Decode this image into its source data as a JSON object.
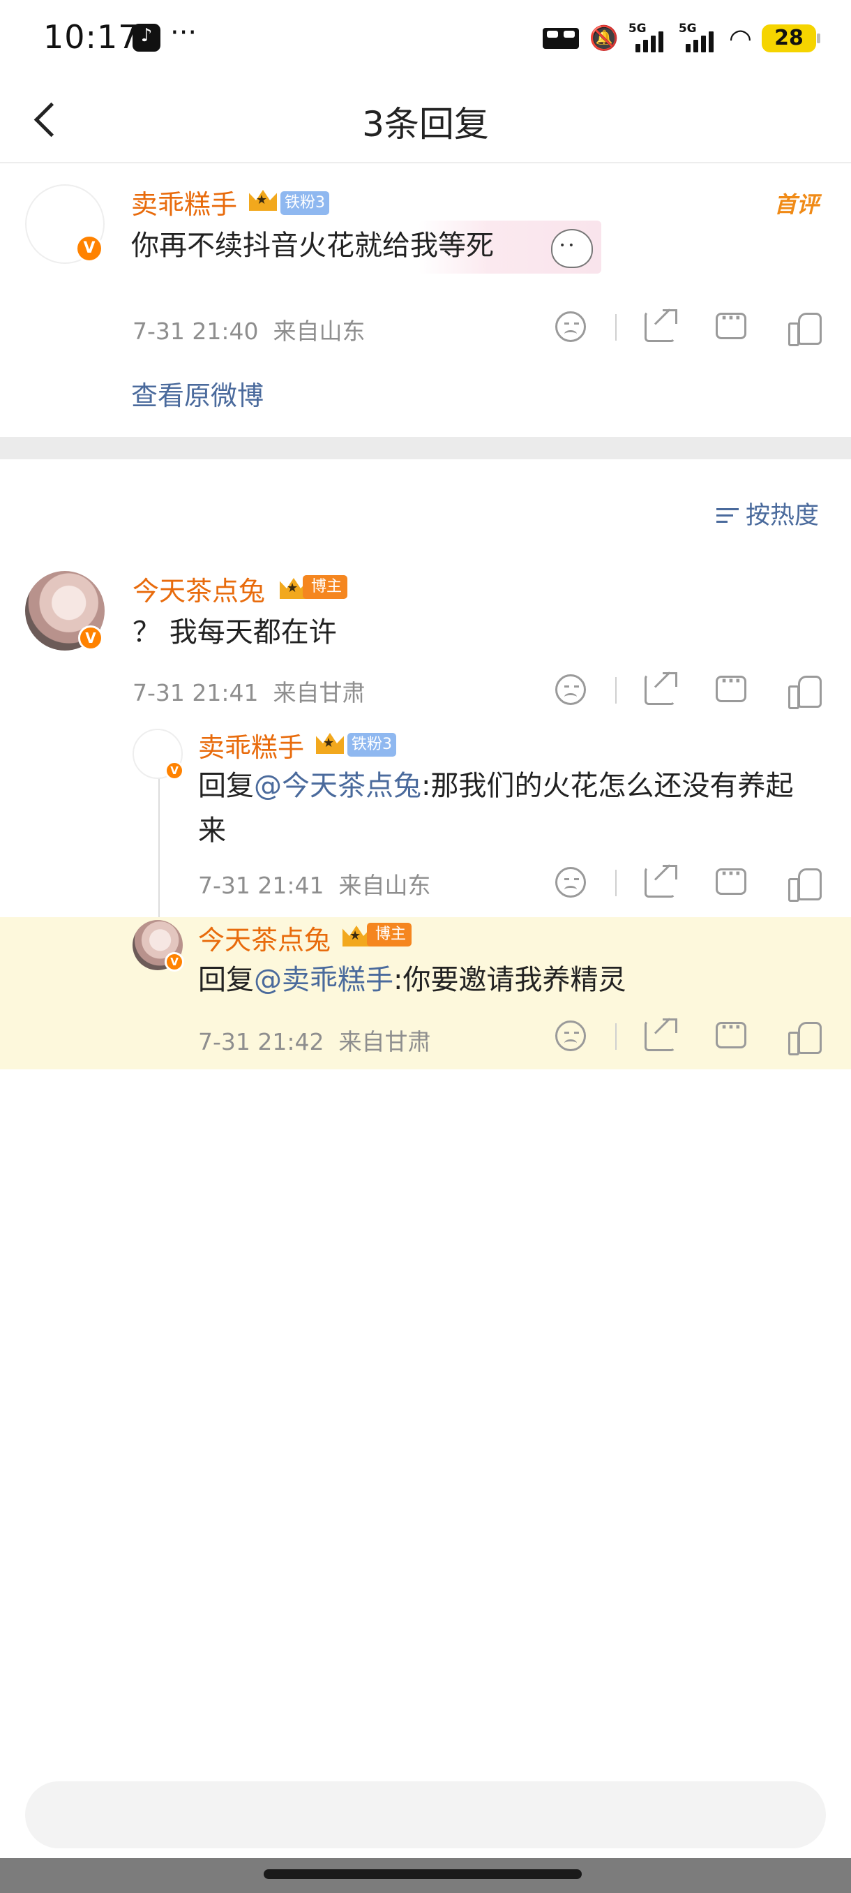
{
  "status_bar": {
    "time": "10:17",
    "more": "···",
    "signal1_label": "5G",
    "signal2_label": "5G",
    "battery": "28"
  },
  "header": {
    "title": "3条回复"
  },
  "main_comment": {
    "username": "卖乖糕手",
    "fan_badge": "铁粉3",
    "text": "你再不续抖音火花就给我等死",
    "time": "7-31 21:40",
    "location": "来自山东",
    "tag": "首评",
    "view_original": "查看原微博"
  },
  "sort": {
    "label": "按热度"
  },
  "replies": [
    {
      "username": "今天茶点兔",
      "badge": "博主",
      "text": "？ 我每天都在许",
      "time": "7-31 21:41",
      "location": "来自甘肃"
    },
    {
      "username": "卖乖糕手",
      "badge": "铁粉3",
      "prefix": "回复",
      "mention": "@今天茶点兔",
      "text": ":那我们的火花怎么还没有养起来",
      "time": "7-31 21:41",
      "location": "来自山东"
    },
    {
      "username": "今天茶点兔",
      "badge": "博主",
      "prefix": "回复",
      "mention": "@卖乖糕手",
      "text": ":你要邀请我养精灵",
      "time": "7-31 21:42",
      "location": "来自甘肃"
    }
  ],
  "icons": {
    "back": "chevron-left-icon",
    "dislike": "sad-face-icon",
    "share": "share-icon",
    "comment": "comment-icon",
    "like": "thumbs-up-icon",
    "sort": "sort-icon",
    "verified": "verified-v-icon",
    "crown": "crown-icon"
  },
  "colors": {
    "username": "#e86b0c",
    "link": "#4a6a9c",
    "highlight": "#fdf8dc",
    "verified": "#ff8200",
    "fan_badge": "#8fb8f0",
    "host_badge": "#f5861f"
  }
}
